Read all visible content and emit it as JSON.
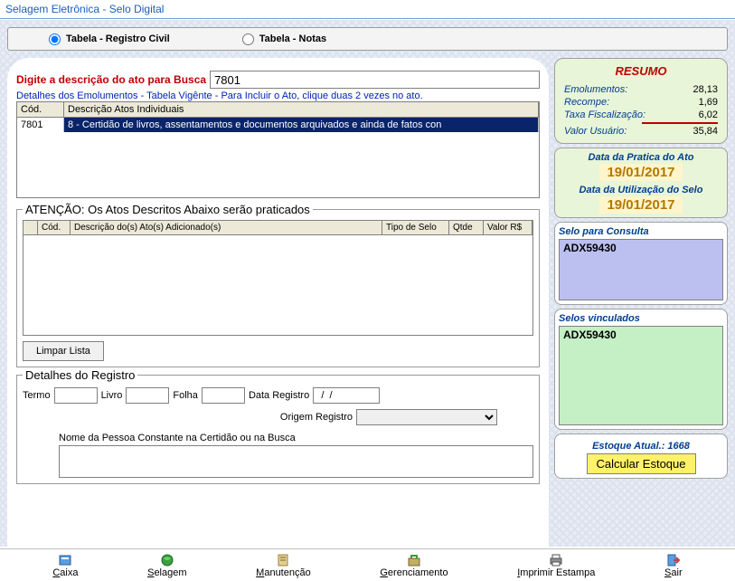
{
  "window": {
    "title": "Selagem Eletrônica - Selo Digital"
  },
  "tabs": {
    "civil": "Tabela - Registro Civil",
    "notas": "Tabela - Notas",
    "selected": "civil"
  },
  "search": {
    "label": "Digite a descrição do ato para Busca",
    "value": "7801",
    "subnote": "Detalhes dos Emolumentos - Tabela Vigênte - Para Incluir o Ato, clique duas 2 vezes no ato."
  },
  "grid1": {
    "headers": {
      "cod": "Cód.",
      "desc": "Descrição Atos Individuais"
    },
    "rows": [
      {
        "cod": "7801",
        "desc": "8 - Certidão de livros, assentamentos e documentos arquivados e ainda de fatos con"
      }
    ]
  },
  "atencao": {
    "legend": "ATENÇÃO: Os Atos Descritos Abaixo serão praticados",
    "headers": {
      "c0": "",
      "c1": "Cód.",
      "c2": "Descrição do(s) Ato(s) Adicionado(s)",
      "c3": "Tipo de Selo",
      "c4": "Qtde",
      "c5": "Valor R$"
    },
    "clear_btn": "Limpar Lista"
  },
  "details": {
    "legend": "Detalhes do Registro",
    "termo_lbl": "Termo",
    "termo": "",
    "livro_lbl": "Livro",
    "livro": "",
    "folha_lbl": "Folha",
    "folha": "",
    "data_lbl": "Data Registro",
    "data": "  /  /",
    "origem_lbl": "Origem Registro",
    "nome_lbl": "Nome da Pessoa Constante na Certidão ou na Busca"
  },
  "resumo": {
    "title": "RESUMO",
    "emol_lbl": "Emolumentos:",
    "emol": "28,13",
    "recompe_lbl": "Recompe:",
    "recompe": "1,69",
    "taxa_lbl": "Taxa Fiscalização:",
    "taxa": "6,02",
    "valor_lbl": "Valor Usuário:",
    "valor": "35,84"
  },
  "dates": {
    "pratica_lbl": "Data da Pratica do Ato",
    "pratica": "19/01/2017",
    "util_lbl": "Data da Utilização do Selo",
    "util": "19/01/2017"
  },
  "selo_consulta": {
    "lbl": "Selo para Consulta",
    "val": "ADX59430"
  },
  "selo_vinc": {
    "lbl": "Selos vinculados",
    "val": "ADX59430"
  },
  "stock": {
    "lbl_prefix": "Estoque Atual.: ",
    "count": "1668",
    "btn": "Calcular Estoque"
  },
  "toolbar": {
    "caixa": "Caixa",
    "selagem": "Selagem",
    "manutencao": "Manutenção",
    "gerenciamento": "Gerenciamento",
    "imprimir": "Imprimir Estampa",
    "sair": "Sair"
  }
}
